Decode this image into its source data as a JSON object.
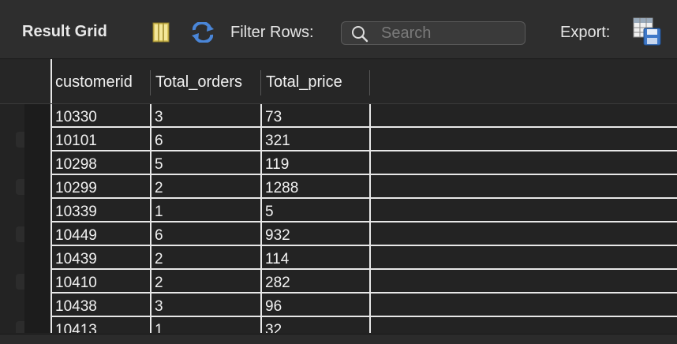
{
  "toolbar": {
    "title": "Result Grid",
    "filter_label": "Filter Rows:",
    "search_placeholder": "Search",
    "export_label": "Export:",
    "icons": [
      "grid-layout-icon",
      "refresh-icon",
      "search-icon",
      "export-icon"
    ]
  },
  "columns": [
    "customerid",
    "Total_orders",
    "Total_price"
  ],
  "rows": [
    [
      "10330",
      "3",
      "73"
    ],
    [
      "10101",
      "6",
      "321"
    ],
    [
      "10298",
      "5",
      "119"
    ],
    [
      "10299",
      "2",
      "1288"
    ],
    [
      "10339",
      "1",
      "5"
    ],
    [
      "10449",
      "6",
      "932"
    ],
    [
      "10439",
      "2",
      "114"
    ],
    [
      "10410",
      "2",
      "282"
    ],
    [
      "10438",
      "3",
      "96"
    ],
    [
      "10413",
      "1",
      "32"
    ]
  ],
  "colors": {
    "background": "#232323",
    "toolbar": "#2e2e2e",
    "grid_line": "#e8e8e8",
    "text": "#f2f2f2",
    "icon_accent": "#4a86d8"
  }
}
